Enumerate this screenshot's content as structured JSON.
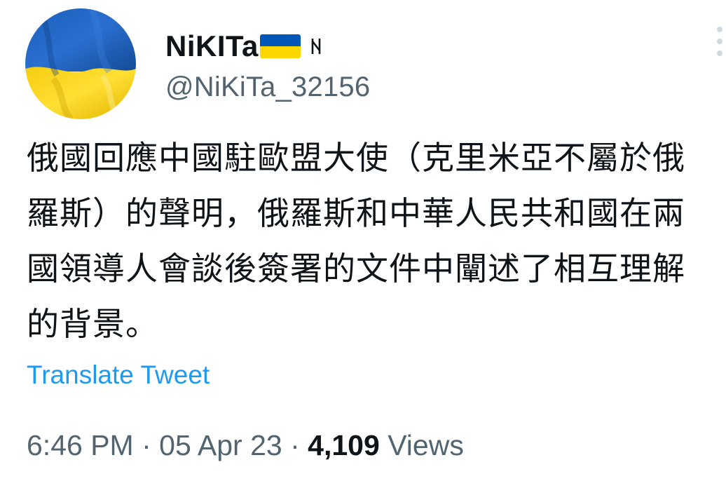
{
  "author": {
    "display_name": "NiKITa",
    "handle": "@NiKiTa_32156",
    "flag_icon": "ukraine-flag-icon",
    "rune_icon": "rune-icon",
    "avatar_icon": "ukraine-flag-avatar"
  },
  "tweet": {
    "text": "俄國回應中國駐歐盟大使（克里米亞不屬於俄羅斯）的聲明，俄羅斯和中華人民共和國在兩國領導人會談後簽署的文件中闡述了相互理解的背景。",
    "translate_label": "Translate Tweet"
  },
  "meta": {
    "time": "6:46 PM",
    "separator": "·",
    "date": "05 Apr 23",
    "views_count": "4,109",
    "views_label": "Views"
  },
  "colors": {
    "flag_blue": "#0057b7",
    "flag_yellow": "#ffd700",
    "link": "#1d9bf0",
    "secondary_text": "#536471",
    "primary_text": "#0f1419"
  },
  "icons": {
    "more": "more-vertical-icon"
  }
}
